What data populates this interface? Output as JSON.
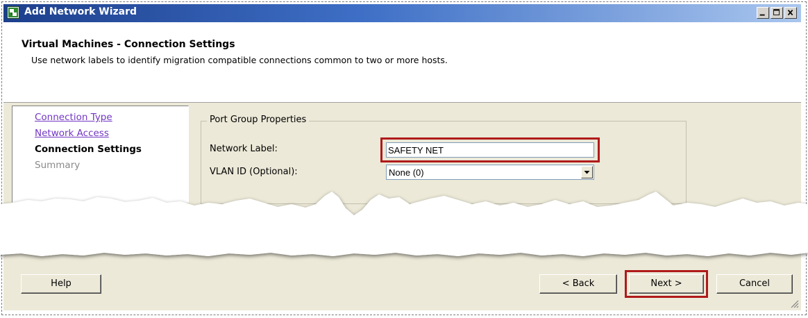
{
  "window": {
    "title": "Add Network Wizard",
    "controls": [
      "minimize",
      "maximize",
      "close"
    ]
  },
  "header": {
    "title": "Virtual Machines - Connection Settings",
    "subtitle": "Use network labels to identify migration compatible connections common to two or more hosts."
  },
  "nav": {
    "items": [
      {
        "label": "Connection Type",
        "state": "link"
      },
      {
        "label": "Network Access",
        "state": "link"
      },
      {
        "label": "Connection Settings",
        "state": "current"
      },
      {
        "label": "Summary",
        "state": "disabled"
      }
    ]
  },
  "port_group": {
    "legend": "Port Group Properties",
    "network_label": {
      "label": "Network Label:",
      "value": "SAFETY NET"
    },
    "vlan": {
      "label": "VLAN ID (Optional):",
      "selected": "None (0)"
    }
  },
  "buttons": {
    "help": "Help",
    "back": "< Back",
    "next": "Next >",
    "cancel": "Cancel"
  },
  "colors": {
    "highlight": "#b01a1a",
    "link": "#7236c4",
    "titlebar_start": "#1d3f8c",
    "titlebar_end": "#a9c6ee"
  }
}
